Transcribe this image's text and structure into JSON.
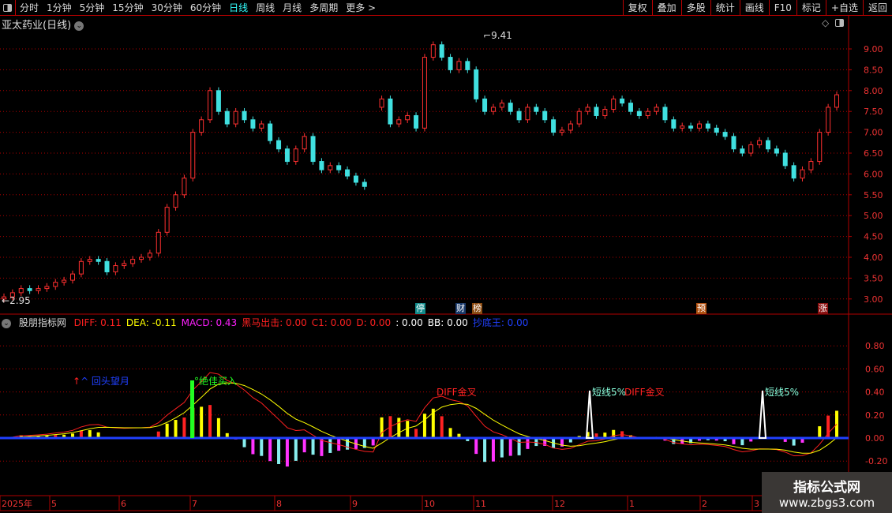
{
  "toolbar": {
    "periods": [
      "分时",
      "1分钟",
      "5分钟",
      "15分钟",
      "30分钟",
      "60分钟",
      "日线",
      "周线",
      "月线",
      "多周期",
      "更多 >"
    ],
    "active": "日线",
    "buttons": [
      "复权",
      "叠加",
      "多股",
      "统计",
      "画线",
      "F10",
      "标记",
      "+自选",
      "返回"
    ]
  },
  "title": "亚太药业(日线)",
  "indicator": {
    "name": "股朋指标网",
    "items": [
      {
        "label": "DIFF: 0.11",
        "color": "#ff2020"
      },
      {
        "label": "DEA: -0.11",
        "color": "#ffff00"
      },
      {
        "label": "MACD: 0.43",
        "color": "#ff20ff"
      },
      {
        "label": "黑马出击: 0.00",
        "color": "#ff2020"
      },
      {
        "label": "C1: 0.00",
        "color": "#ff2020"
      },
      {
        "label": "D: 0.00",
        "color": "#ff2020"
      },
      {
        "label": ": 0.00",
        "color": "#ffffff"
      },
      {
        "label": "BB: 0.00",
        "color": "#ffffff"
      },
      {
        "label": "抄底王: 0.00",
        "color": "#2040ff"
      }
    ]
  },
  "annotations": {
    "high": "9.41",
    "low": "2.95",
    "huitou": "^ 回头望月",
    "juejia": "绝佳买入",
    "diff1": "DIFF金叉",
    "duan1": "短线5%",
    "diff2": "DIFF金叉",
    "duan2": "短线5%"
  },
  "tags": [
    {
      "text": "停",
      "color": "#128a8a"
    },
    {
      "text": "财",
      "color": "#1a3a6a"
    },
    {
      "text": "榜",
      "color": "#8a4a10"
    },
    {
      "text": "预",
      "color": "#b05010"
    },
    {
      "text": "涨",
      "color": "#8a1010"
    }
  ],
  "watermark": {
    "line1": "指标公式网",
    "line2": "www.zbgs3.com"
  },
  "colors": {
    "up": "#ff3030",
    "down": "#40e0e0",
    "grid": "#b00000",
    "diff": "#ff2020",
    "dea": "#ffff00"
  },
  "chart_data": {
    "type": "candlestick",
    "price_axis": {
      "ticks": [
        "9.00",
        "8.50",
        "8.00",
        "7.50",
        "7.00",
        "6.50",
        "6.00",
        "5.50",
        "5.00",
        "4.50",
        "4.00",
        "3.50",
        "3.00"
      ],
      "range": [
        2.85,
        9.5
      ]
    },
    "macd_axis": {
      "ticks": [
        "0.80",
        "0.60",
        "0.40",
        "0.20",
        "0.00",
        "-0.20"
      ],
      "range": [
        -0.45,
        0.9
      ]
    },
    "x_ticks": [
      "2025年",
      "5",
      "6",
      "7",
      "8",
      "9",
      "10",
      "11",
      "12",
      "1",
      "2",
      "3"
    ],
    "closes": [
      3.05,
      3.15,
      3.25,
      3.2,
      3.25,
      3.3,
      3.4,
      3.45,
      3.6,
      3.9,
      3.95,
      3.9,
      3.65,
      3.8,
      3.85,
      3.95,
      4.0,
      4.1,
      4.6,
      5.2,
      5.5,
      5.9,
      7.0,
      7.3,
      8.0,
      7.5,
      7.2,
      7.5,
      7.3,
      7.1,
      7.2,
      6.8,
      6.6,
      6.3,
      6.6,
      6.9,
      6.3,
      6.1,
      6.2,
      6.1,
      5.95,
      5.8,
      5.7,
      null,
      7.8,
      7.2,
      7.3,
      7.4,
      7.1,
      8.8,
      9.1,
      8.8,
      8.5,
      8.7,
      8.5,
      7.8,
      7.5,
      7.6,
      7.7,
      7.5,
      7.3,
      7.6,
      7.5,
      7.3,
      7.0,
      7.05,
      7.2,
      7.5,
      7.6,
      7.4,
      7.55,
      7.8,
      7.7,
      7.5,
      7.4,
      7.5,
      7.6,
      7.3,
      7.1,
      7.15,
      7.1,
      7.2,
      7.1,
      7.0,
      6.9,
      6.6,
      6.5,
      6.7,
      6.8,
      6.6,
      6.5,
      6.2,
      5.9,
      6.1,
      6.3,
      7.0,
      7.6,
      7.9
    ]
  }
}
